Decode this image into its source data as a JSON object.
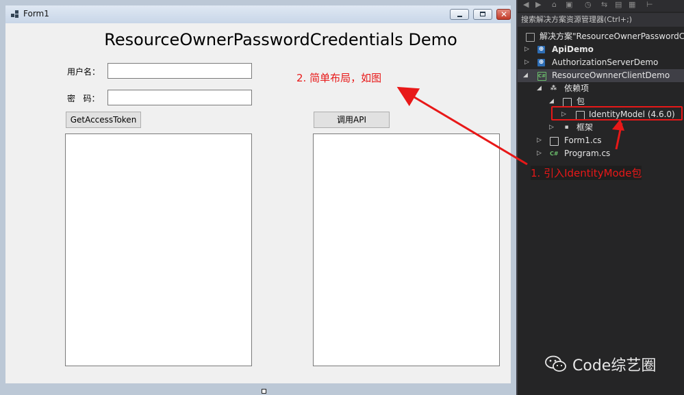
{
  "form": {
    "title": "Form1",
    "heading": "ResourceOwnerPasswordCredentials Demo",
    "username_label": "用户名：",
    "password_label": "密  码：",
    "username_value": "",
    "password_value": "",
    "get_token_button": "GetAccessToken",
    "call_api_button": "调用API"
  },
  "annotations": {
    "step1": "1. 引入IdentityMode包",
    "step2": "2. 简单布局，如图",
    "color": "#e81818"
  },
  "explorer": {
    "search_placeholder": "搜索解决方案资源管理器(Ctrl+;)",
    "items": [
      {
        "label": "解决方案\"ResourceOwnerPasswordCr",
        "icon": "solution-icon"
      },
      {
        "label": "ApiDemo",
        "icon": "web-project-icon"
      },
      {
        "label": "AuthorizationServerDemo",
        "icon": "web-project-icon"
      },
      {
        "label": "ResourceOwnnerClientDemo",
        "icon": "csharp-project-icon"
      },
      {
        "label": "依赖项",
        "icon": "dependencies-icon"
      },
      {
        "label": "包",
        "icon": "package-icon"
      },
      {
        "label": "IdentityModel (4.6.0)",
        "icon": "package-icon"
      },
      {
        "label": "框架",
        "icon": "framework-icon"
      },
      {
        "label": "Form1.cs",
        "icon": "form-file-icon"
      },
      {
        "label": "Program.cs",
        "icon": "csharp-file-icon"
      }
    ]
  },
  "watermark": {
    "text": "Code综艺圈",
    "icon": "wechat-icon"
  }
}
